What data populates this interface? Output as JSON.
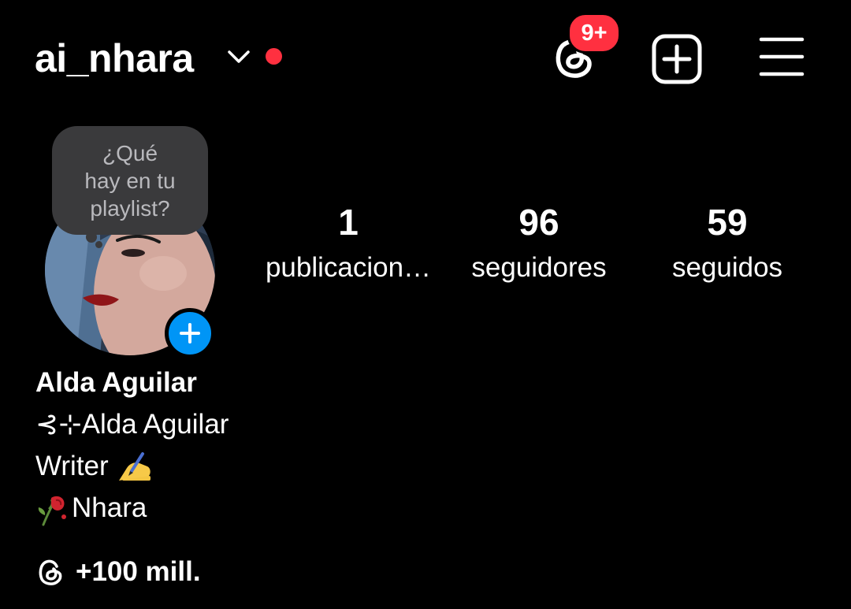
{
  "header": {
    "username": "ai_nhara",
    "account_switch_icon": "chevron-down-icon",
    "threads_icon": "threads-icon",
    "threads_badge": "9+",
    "new_post_icon": "plus-square-icon",
    "menu_icon": "hamburger-menu-icon"
  },
  "note": {
    "line1": "¿Qué",
    "line2": "hay en tu",
    "line3": "playlist?"
  },
  "stats": {
    "posts_count": "1",
    "posts_label": "publicacion…",
    "followers_count": "96",
    "followers_label": "seguidores",
    "following_count": "59",
    "following_label": "seguidos"
  },
  "bio": {
    "display_name": "Alda Aguilar",
    "line1": "⊰⊹Alda Aguilar",
    "line2_text": "Writer ",
    "line2_emoji": "writing-hand-icon",
    "line3_emoji": "wilted-rose-icon",
    "line3_text": "Nhara"
  },
  "threads_link": {
    "icon": "threads-icon",
    "label": "+100 mill."
  },
  "colors": {
    "background": "#000000",
    "text": "#ffffff",
    "badge": "#ff3040",
    "online_dot": "#ff3040",
    "add_story": "#0095f6",
    "note_bubble": "#3a3a3c",
    "note_text": "#b9b9bd"
  }
}
